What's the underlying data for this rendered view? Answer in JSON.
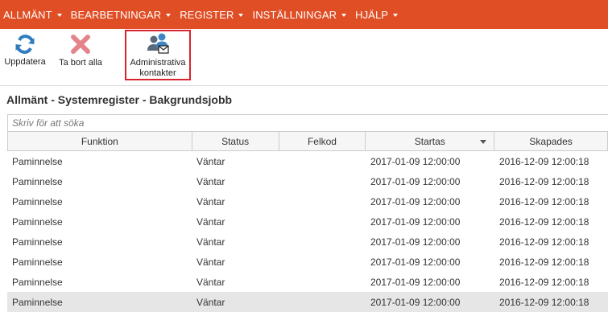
{
  "menu": {
    "items": [
      {
        "label": "ALLMÄNT"
      },
      {
        "label": "BEARBETNINGAR"
      },
      {
        "label": "REGISTER"
      },
      {
        "label": "INSTÄLLNINGAR"
      },
      {
        "label": "HJÄLP"
      }
    ]
  },
  "toolbar": {
    "refresh_label": "Uppdatera",
    "delete_all_label": "Ta bort alla",
    "admin_contacts_line1": "Administrativa",
    "admin_contacts_line2": "kontakter"
  },
  "breadcrumb": "Allmänt - Systemregister - Bakgrundsjobb",
  "search": {
    "placeholder": "Skriv för att söka",
    "value": ""
  },
  "table": {
    "columns": [
      "Funktion",
      "Status",
      "Felkod",
      "Startas",
      "Skapades"
    ],
    "sorted_column": "Startas",
    "sort_direction": "descending",
    "rows": [
      {
        "funktion": "Paminnelse",
        "status": "Väntar",
        "felkod": "",
        "startas": "2017-01-09 12:00:00",
        "skapades": "2016-12-09 12:00:18"
      },
      {
        "funktion": "Paminnelse",
        "status": "Väntar",
        "felkod": "",
        "startas": "2017-01-09 12:00:00",
        "skapades": "2016-12-09 12:00:18"
      },
      {
        "funktion": "Paminnelse",
        "status": "Väntar",
        "felkod": "",
        "startas": "2017-01-09 12:00:00",
        "skapades": "2016-12-09 12:00:18"
      },
      {
        "funktion": "Paminnelse",
        "status": "Väntar",
        "felkod": "",
        "startas": "2017-01-09 12:00:00",
        "skapades": "2016-12-09 12:00:18"
      },
      {
        "funktion": "Paminnelse",
        "status": "Väntar",
        "felkod": "",
        "startas": "2017-01-09 12:00:00",
        "skapades": "2016-12-09 12:00:18"
      },
      {
        "funktion": "Paminnelse",
        "status": "Väntar",
        "felkod": "",
        "startas": "2017-01-09 12:00:00",
        "skapades": "2016-12-09 12:00:18"
      },
      {
        "funktion": "Paminnelse",
        "status": "Väntar",
        "felkod": "",
        "startas": "2017-01-09 12:00:00",
        "skapades": "2016-12-09 12:00:18"
      },
      {
        "funktion": "Paminnelse",
        "status": "Väntar",
        "felkod": "",
        "startas": "2017-01-09 12:00:00",
        "skapades": "2016-12-09 12:00:18"
      }
    ]
  },
  "colors": {
    "menubar_bg": "#e04e25",
    "highlight_border": "#d9232d",
    "refresh_icon": "#2f7cc0",
    "delete_icon": "#e4848a",
    "selected_row_bg": "#e6e6e6"
  },
  "icons": {
    "refresh": "refresh-icon",
    "delete_all": "delete-icon",
    "admin_contacts": "admin-contacts-icon"
  }
}
